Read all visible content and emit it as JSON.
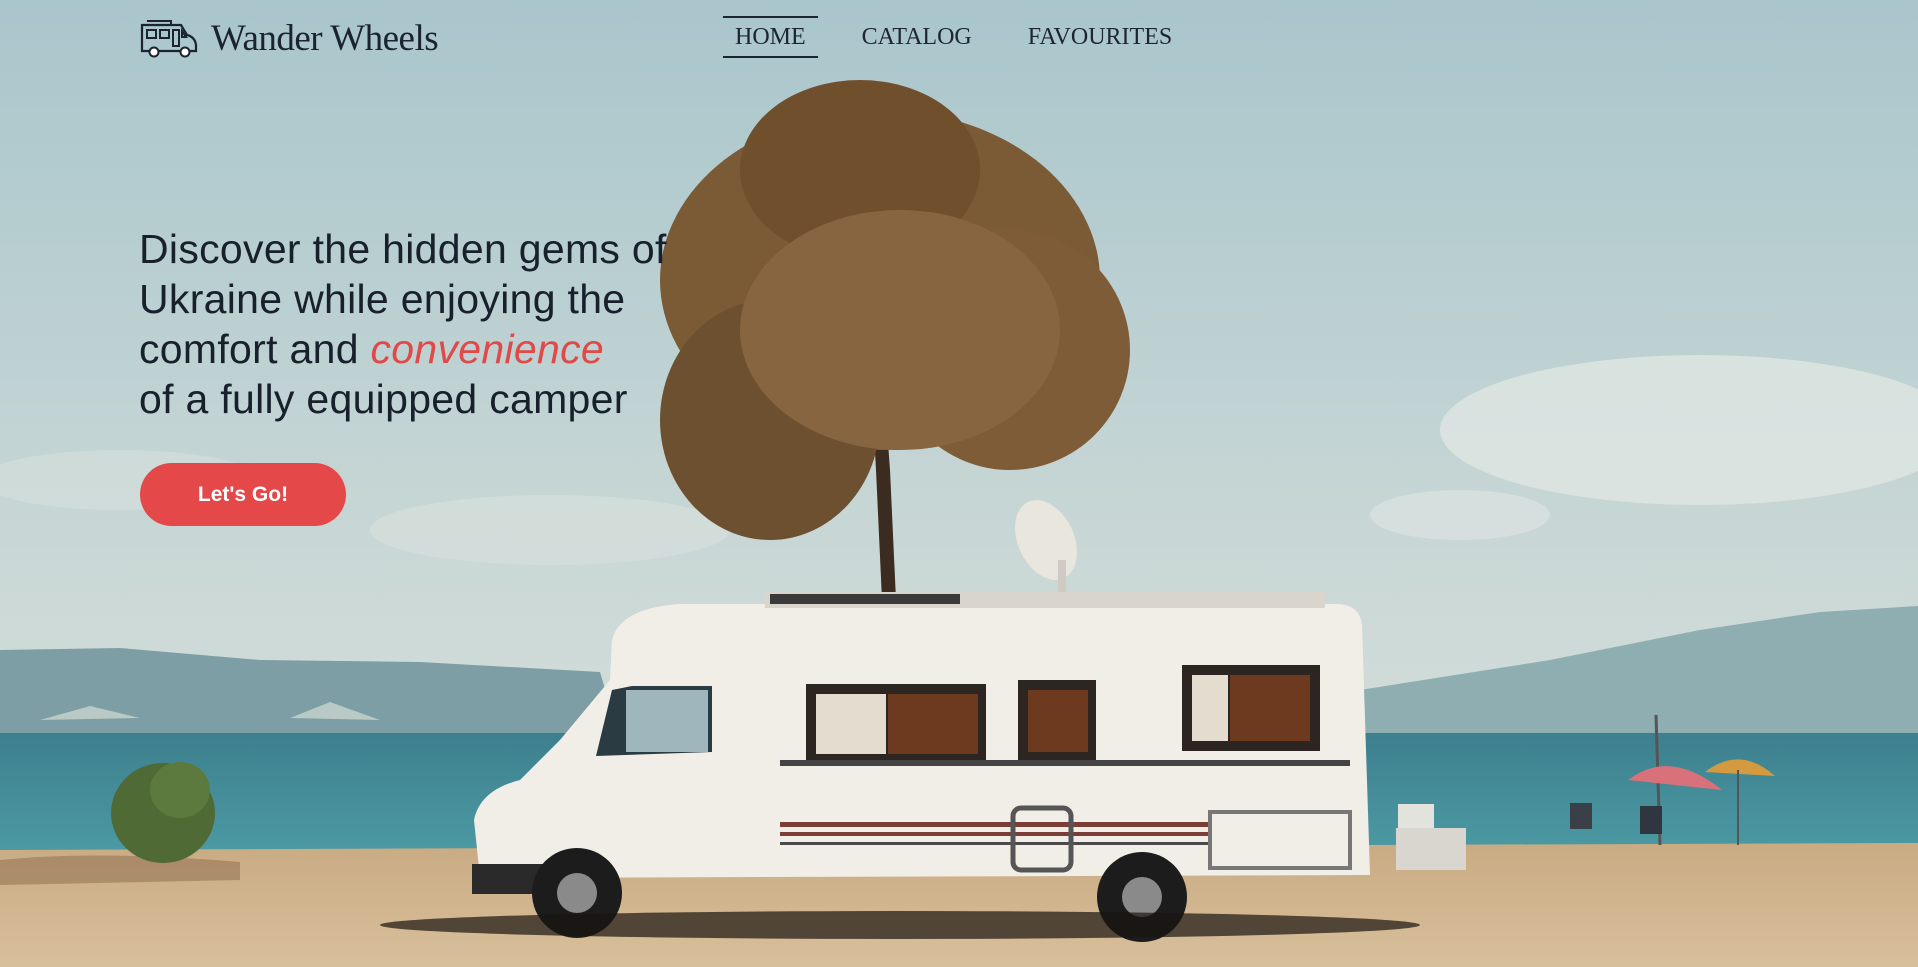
{
  "brand": {
    "name": "Wander Wheels",
    "icon": "camper-van-icon"
  },
  "nav": {
    "items": [
      {
        "label": "HOME",
        "active": true
      },
      {
        "label": "CATALOG",
        "active": false
      },
      {
        "label": "FAVOURITES",
        "active": false
      }
    ]
  },
  "hero": {
    "headline_line1": "Discover the hidden gems of",
    "headline_line2": "Ukraine while enjoying the",
    "headline_line3_pre": "comfort and ",
    "headline_accent": "convenience",
    "headline_line4": "of a fully equipped camper",
    "cta_label": "Let's Go!",
    "background": "photo of a white camper van parked on a sandy beach under a tree by the sea"
  },
  "colors": {
    "accent": "#e44848",
    "text": "#18202c"
  }
}
